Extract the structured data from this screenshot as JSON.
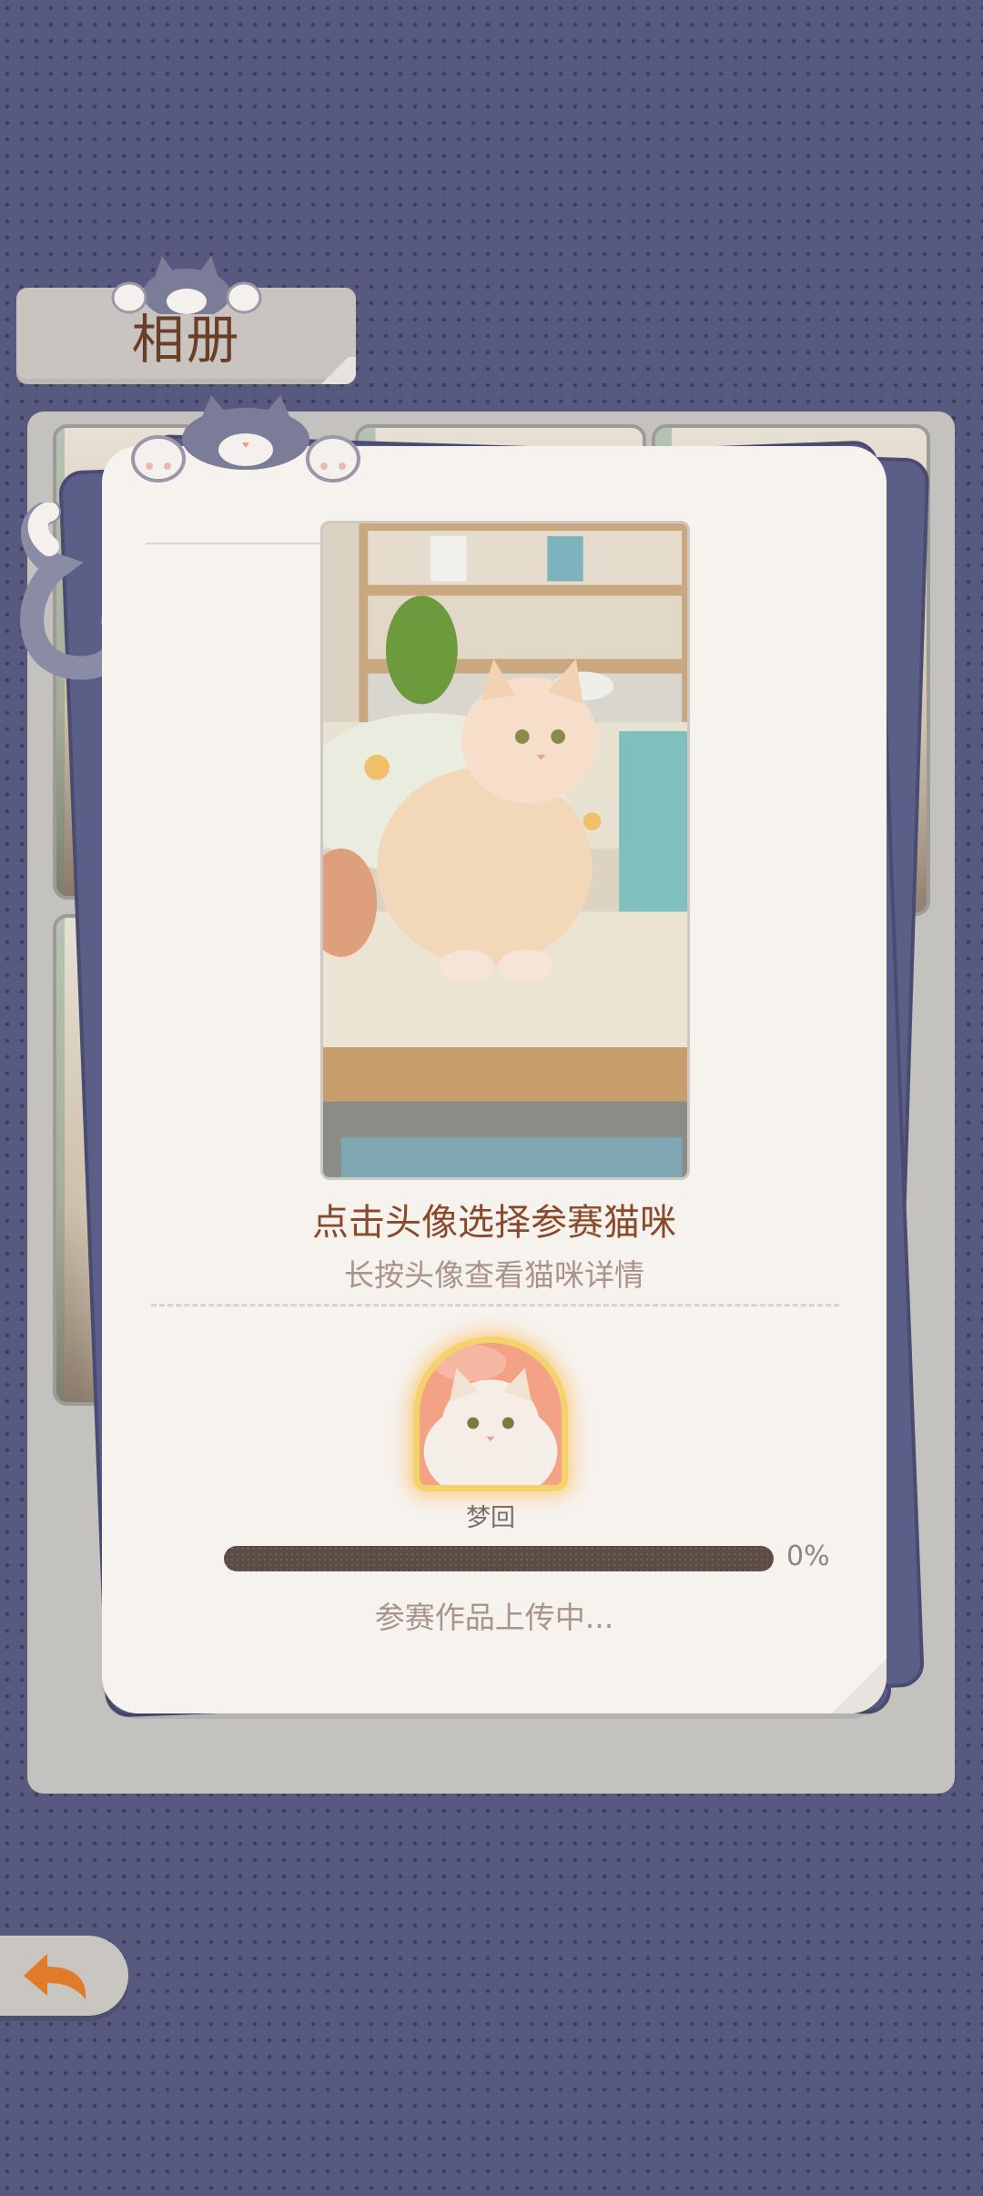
{
  "header": {
    "title": "相册"
  },
  "contest": {
    "prompt_title": "点击头像选择参赛猫咪",
    "prompt_sub": "长按头像查看猫咪详情",
    "selected_cat": {
      "name": "梦回"
    },
    "progress": {
      "value": 0,
      "label": "0%"
    },
    "status": "参赛作品上传中..."
  },
  "nav": {
    "back_icon": "back-arrow-icon"
  },
  "colors": {
    "background": "#575a7e",
    "card": "#f6f2ee",
    "title_text": "#8a4a2a",
    "progress_track": "#5b4c44",
    "avatar_glow": "#f5d36c",
    "back_arrow": "#e07b2a"
  }
}
